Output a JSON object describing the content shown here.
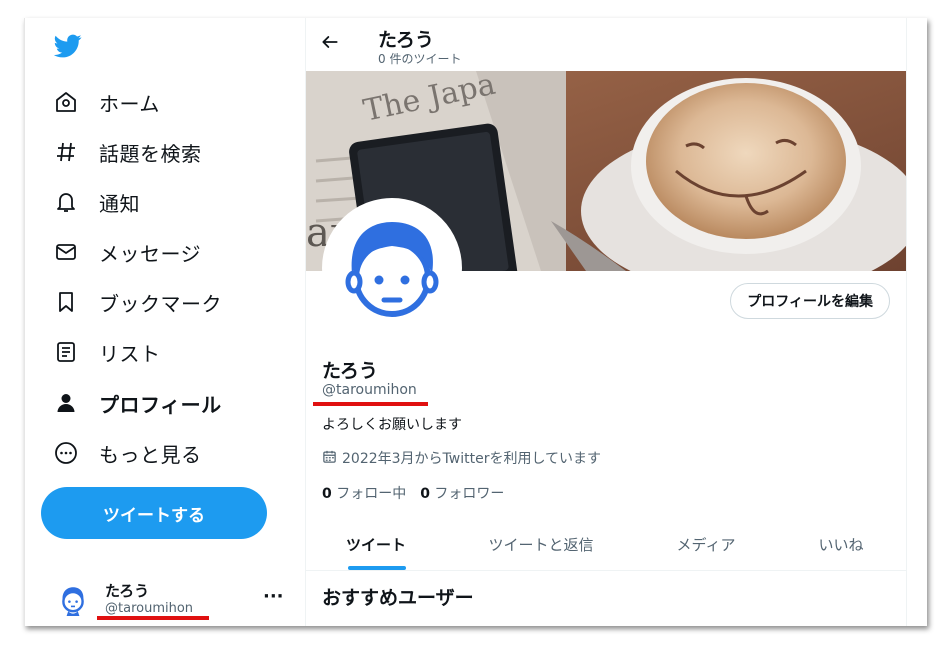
{
  "nav": {
    "items": [
      {
        "label": "ホーム",
        "icon": "home-icon"
      },
      {
        "label": "話題を検索",
        "icon": "hashtag-icon"
      },
      {
        "label": "通知",
        "icon": "bell-icon"
      },
      {
        "label": "メッセージ",
        "icon": "envelope-icon"
      },
      {
        "label": "ブックマーク",
        "icon": "bookmark-icon"
      },
      {
        "label": "リスト",
        "icon": "list-icon"
      },
      {
        "label": "プロフィール",
        "icon": "person-icon"
      },
      {
        "label": "もっと見る",
        "icon": "more-circle-icon"
      }
    ],
    "active": "プロフィール",
    "tweet_button": "ツイートする",
    "account": {
      "name": "たろう",
      "handle": "@taroumihon",
      "more": "···"
    }
  },
  "header": {
    "name": "たろう",
    "tweet_count": "0 件のツイート",
    "back_icon": "arrow-left-icon"
  },
  "profile": {
    "edit_button": "プロフィールを編集",
    "name": "たろう",
    "handle": "@taroumihon",
    "bio": "よろしくお願いします",
    "joined": "2022年3月からTwitterを利用しています",
    "following_count": "0",
    "following_label": "フォロー中",
    "followers_count": "0",
    "followers_label": "フォロワー"
  },
  "tabs": [
    "ツイート",
    "ツイートと返信",
    "メディア",
    "いいね"
  ],
  "active_tab": "ツイート",
  "suggestions_title": "おすすめユーザー",
  "colors": {
    "accent": "#1d9bf0",
    "highlight": "#e01010",
    "avatar": "#2f6fe0"
  }
}
